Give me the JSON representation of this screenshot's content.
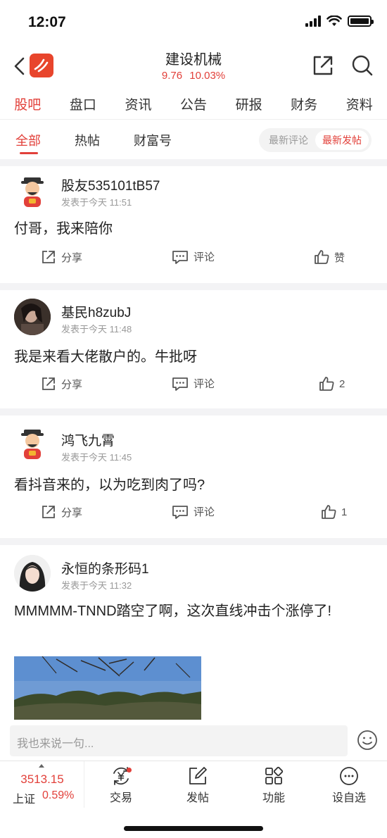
{
  "status_bar": {
    "time": "12:07"
  },
  "header": {
    "title": "建设机械",
    "price": "9.76",
    "change_pct": "10.03%"
  },
  "main_tabs": [
    "股吧",
    "盘口",
    "资讯",
    "公告",
    "研报",
    "财务",
    "资料"
  ],
  "sub_tabs": [
    "全部",
    "热帖",
    "财富号"
  ],
  "sort_options": [
    "最新评论",
    "最新发帖"
  ],
  "posts": [
    {
      "username": "股友535101tB57",
      "time": "发表于今天 11:51",
      "content": "付哥，我来陪你",
      "share": "分享",
      "comment": "评论",
      "like": "赞"
    },
    {
      "username": "基民h8zubJ",
      "time": "发表于今天 11:48",
      "content": "我是来看大佬散户的。牛批呀",
      "share": "分享",
      "comment": "评论",
      "like": "2"
    },
    {
      "username": "鸿飞九霄",
      "time": "发表于今天 11:45",
      "content": "看抖音来的，以为吃到肉了吗?",
      "share": "分享",
      "comment": "评论",
      "like": "1"
    },
    {
      "username": "永恒的条形码1",
      "time": "发表于今天 11:32",
      "content": "MMMMM-TNND踏空了啊，这次直线冲击个涨停了!"
    }
  ],
  "comment_bar": {
    "placeholder": "我也来说一句..."
  },
  "bottom_nav": {
    "index_value": "3513.15",
    "index_name": "上证",
    "index_change": "0.59%",
    "items": [
      "交易",
      "发帖",
      "功能",
      "设自选"
    ]
  },
  "colors": {
    "accent": "#e2403a",
    "logo": "#e8452c"
  }
}
